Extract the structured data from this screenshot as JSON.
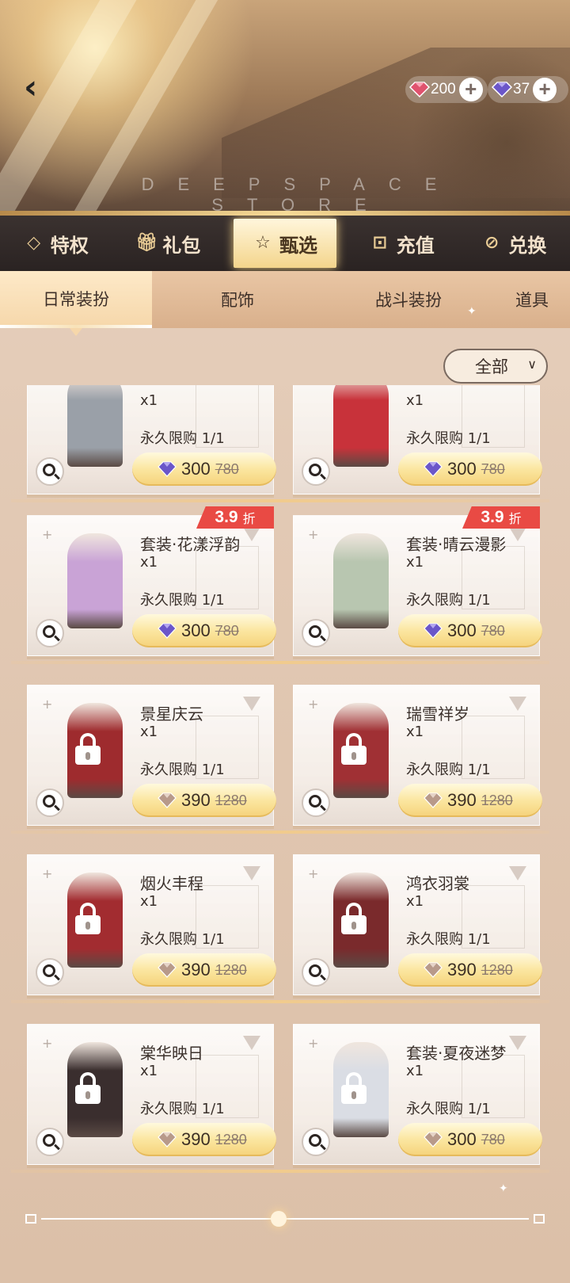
{
  "header": {
    "store_title": "DEEPSPACE STORE",
    "currency": [
      {
        "icon": "pink-crystal-icon",
        "value": "200",
        "color": "#e0536e"
      },
      {
        "icon": "purple-crystal-icon",
        "value": "37",
        "color": "#6b56c9"
      }
    ]
  },
  "main_tabs": [
    {
      "icon": "diamond-icon",
      "label": "特权"
    },
    {
      "icon": "gift-icon",
      "label": "礼包"
    },
    {
      "icon": "star-icon",
      "label": "甄选",
      "active": true
    },
    {
      "icon": "recharge-icon",
      "label": "充值"
    },
    {
      "icon": "exchange-icon",
      "label": "兑换"
    }
  ],
  "sub_tabs": [
    {
      "label": "日常装扮",
      "active": true
    },
    {
      "label": "配饰"
    },
    {
      "label": "战斗装扮"
    },
    {
      "label": "道具"
    }
  ],
  "filter": {
    "label": "全部"
  },
  "items": [
    {
      "name": "",
      "qty": "x1",
      "limit": "永久限购 1/1",
      "price": "300",
      "old_price": "780",
      "locked": false,
      "figure_color": "#9aa0a8"
    },
    {
      "name": "",
      "qty": "x1",
      "limit": "永久限购 1/1",
      "price": "300",
      "old_price": "780",
      "locked": false,
      "figure_color": "#c8323a"
    },
    {
      "name": "套装·花漾浮韵",
      "qty": "x1",
      "limit": "永久限购 1/1",
      "price": "300",
      "old_price": "780",
      "locked": false,
      "discount": "3.9",
      "discount_unit": "折",
      "figure_color": "#c9a3d6"
    },
    {
      "name": "套装·晴云漫影",
      "qty": "x1",
      "limit": "永久限购 1/1",
      "price": "300",
      "old_price": "780",
      "locked": false,
      "discount": "3.9",
      "discount_unit": "折",
      "figure_color": "#b8c6b0"
    },
    {
      "name": "景星庆云",
      "qty": "x1",
      "limit": "永久限购 1/1",
      "price": "390",
      "old_price": "1280",
      "locked": true,
      "figure_color": "#9e2b2e"
    },
    {
      "name": "瑞雪祥岁",
      "qty": "x1",
      "limit": "永久限购 1/1",
      "price": "390",
      "old_price": "1280",
      "locked": true,
      "figure_color": "#a03034"
    },
    {
      "name": "烟火丰程",
      "qty": "x1",
      "limit": "永久限购 1/1",
      "price": "390",
      "old_price": "1280",
      "locked": true,
      "figure_color": "#a22c30"
    },
    {
      "name": "鸿衣羽裳",
      "qty": "x1",
      "limit": "永久限购 1/1",
      "price": "390",
      "old_price": "1280",
      "locked": true,
      "figure_color": "#7a2a2c"
    },
    {
      "name": "棠华映日",
      "qty": "x1",
      "limit": "永久限购 1/1",
      "price": "390",
      "old_price": "1280",
      "locked": true,
      "figure_color": "#3a2e2e"
    },
    {
      "name": "套装·夏夜迷梦",
      "qty": "x1",
      "limit": "永久限购 1/1",
      "price": "300",
      "old_price": "780",
      "locked": true,
      "figure_color": "#dadde4"
    }
  ]
}
